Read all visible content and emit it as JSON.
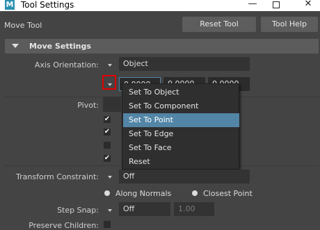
{
  "window": {
    "title": "Tool Settings",
    "app_icon_letter": "M"
  },
  "controls": {
    "minimize": "—",
    "close": "✕"
  },
  "header": {
    "tool_name": "Move Tool",
    "reset_label": "Reset Tool",
    "help_label": "Tool Help"
  },
  "frame": {
    "title": "Move Settings"
  },
  "axis_orientation": {
    "label": "Axis Orientation:",
    "value": "Object",
    "coords": [
      "0.0000",
      "0.0000",
      "0.0000"
    ]
  },
  "pivot": {
    "label": "Pivot:"
  },
  "menu": {
    "items": [
      {
        "label": "Set To Object"
      },
      {
        "label": "Set To Component"
      },
      {
        "label": "Set To Point"
      },
      {
        "label": "Set To Edge"
      },
      {
        "label": "Set To Face"
      },
      {
        "label": "Reset"
      }
    ],
    "selected": "Set To Point"
  },
  "transform_constraint": {
    "label": "Transform Constraint:",
    "value": "Off",
    "radio_along": "Along Normals",
    "radio_closest": "Closest Point"
  },
  "step_snap": {
    "label": "Step Snap:",
    "value": "Off",
    "amount": "1.00"
  },
  "preserve_children": {
    "label": "Preserve Children:"
  },
  "colors": {
    "accent_selected": "#5285a6",
    "highlight_box": "#e00000"
  }
}
